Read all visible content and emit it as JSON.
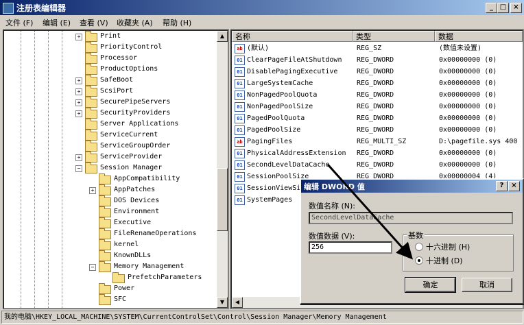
{
  "window": {
    "title": "注册表编辑器",
    "min_label": "_",
    "max_label": "□",
    "close_label": "×"
  },
  "menu": [
    "文件 (F)",
    "编辑 (E)",
    "查看 (V)",
    "收藏夹 (A)",
    "帮助 (H)"
  ],
  "tree": {
    "items": [
      {
        "label": "Print",
        "level": 0,
        "expander": "+"
      },
      {
        "label": "PriorityControl",
        "level": 0,
        "expander": ""
      },
      {
        "label": "Processor",
        "level": 0,
        "expander": ""
      },
      {
        "label": "ProductOptions",
        "level": 0,
        "expander": ""
      },
      {
        "label": "SafeBoot",
        "level": 0,
        "expander": "+"
      },
      {
        "label": "ScsiPort",
        "level": 0,
        "expander": "+"
      },
      {
        "label": "SecurePipeServers",
        "level": 0,
        "expander": "+"
      },
      {
        "label": "SecurityProviders",
        "level": 0,
        "expander": "+"
      },
      {
        "label": "Server Applications",
        "level": 0,
        "expander": ""
      },
      {
        "label": "ServiceCurrent",
        "level": 0,
        "expander": ""
      },
      {
        "label": "ServiceGroupOrder",
        "level": 0,
        "expander": ""
      },
      {
        "label": "ServiceProvider",
        "level": 0,
        "expander": "+"
      },
      {
        "label": "Session Manager",
        "level": 0,
        "expander": "−"
      },
      {
        "label": "AppCompatibility",
        "level": 1,
        "expander": ""
      },
      {
        "label": "AppPatches",
        "level": 1,
        "expander": "+"
      },
      {
        "label": "DOS Devices",
        "level": 1,
        "expander": ""
      },
      {
        "label": "Environment",
        "level": 1,
        "expander": ""
      },
      {
        "label": "Executive",
        "level": 1,
        "expander": ""
      },
      {
        "label": "FileRenameOperations",
        "level": 1,
        "expander": ""
      },
      {
        "label": "kernel",
        "level": 1,
        "expander": ""
      },
      {
        "label": "KnownDLLs",
        "level": 1,
        "expander": ""
      },
      {
        "label": "Memory Management",
        "level": 1,
        "expander": "−"
      },
      {
        "label": "PrefetchParameters",
        "level": 2,
        "expander": ""
      },
      {
        "label": "Power",
        "level": 1,
        "expander": ""
      },
      {
        "label": "SFC",
        "level": 1,
        "expander": ""
      }
    ]
  },
  "list": {
    "columns": [
      "名称",
      "类型",
      "数据"
    ],
    "rows": [
      {
        "icon": "ab",
        "name": "(默认)",
        "type": "REG_SZ",
        "data": "(数值未设置)"
      },
      {
        "icon": "01",
        "name": "ClearPageFileAtShutdown",
        "type": "REG_DWORD",
        "data": "0x00000000 (0)"
      },
      {
        "icon": "01",
        "name": "DisablePagingExecutive",
        "type": "REG_DWORD",
        "data": "0x00000000 (0)"
      },
      {
        "icon": "01",
        "name": "LargeSystemCache",
        "type": "REG_DWORD",
        "data": "0x00000000 (0)"
      },
      {
        "icon": "01",
        "name": "NonPagedPoolQuota",
        "type": "REG_DWORD",
        "data": "0x00000000 (0)"
      },
      {
        "icon": "01",
        "name": "NonPagedPoolSize",
        "type": "REG_DWORD",
        "data": "0x00000000 (0)"
      },
      {
        "icon": "01",
        "name": "PagedPoolQuota",
        "type": "REG_DWORD",
        "data": "0x00000000 (0)"
      },
      {
        "icon": "01",
        "name": "PagedPoolSize",
        "type": "REG_DWORD",
        "data": "0x00000000 (0)"
      },
      {
        "icon": "ab",
        "name": "PagingFiles",
        "type": "REG_MULTI_SZ",
        "data": "D:\\pagefile.sys 400"
      },
      {
        "icon": "01",
        "name": "PhysicalAddressExtension",
        "type": "REG_DWORD",
        "data": "0x00000000 (0)"
      },
      {
        "icon": "01",
        "name": "SecondLevelDataCache",
        "type": "REG_DWORD",
        "data": "0x00000000 (0)"
      },
      {
        "icon": "01",
        "name": "SessionPoolSize",
        "type": "REG_DWORD",
        "data": "0x00000004 (4)"
      },
      {
        "icon": "01",
        "name": "SessionViewSi",
        "type": "",
        "data": ""
      },
      {
        "icon": "01",
        "name": "SystemPages",
        "type": "",
        "data": ""
      }
    ]
  },
  "statusbar": {
    "path": "我的电脑\\HKEY_LOCAL_MACHINE\\SYSTEM\\CurrentControlSet\\Control\\Session Manager\\Memory Management"
  },
  "dialog": {
    "title": "编辑 DWORD 值",
    "help_label": "?",
    "close_label": "×",
    "name_label": "数值名称 (N):",
    "name_value": "SecondLevelDataCache",
    "data_label": "数值数据 (V):",
    "data_value": "256",
    "base_group": "基数",
    "hex_label": "十六进制 (H)",
    "dec_label": "十进制 (D)",
    "selected_base": "decimal",
    "ok_label": "确定",
    "cancel_label": "取消"
  }
}
